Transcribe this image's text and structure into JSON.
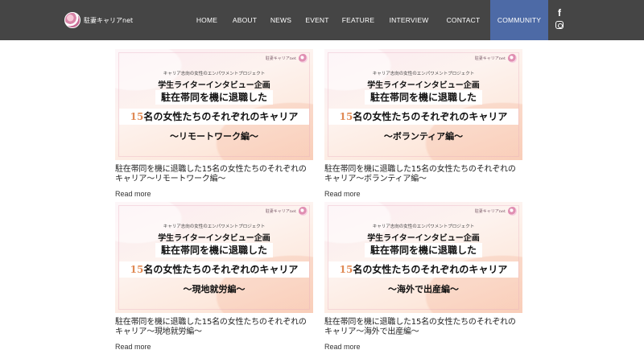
{
  "site": {
    "logo_text": "駐妻キャリアnet"
  },
  "nav": [
    {
      "label": "HOME",
      "active": false
    },
    {
      "label": "ABOUT",
      "active": false
    },
    {
      "label": "NEWS",
      "active": false
    },
    {
      "label": "EVENT",
      "active": false
    },
    {
      "label": "FEATURE",
      "active": false
    },
    {
      "label": "INTERVIEW",
      "active": false
    },
    {
      "label": "CONTACT",
      "active": false
    },
    {
      "label": "COMMUNITY",
      "active": true
    }
  ],
  "social": {
    "facebook_glyph": "f"
  },
  "thumb_common": {
    "brand": "駐妻キャリアnet",
    "project": "キャリア志向の女性のエンパワメントプロジェクト",
    "series": "学生ライターインタビュー企画",
    "line1": "駐在帯同を機に退職した",
    "line2_highlight": "15",
    "line2_rest": "名の女性たちのそれぞれのキャリア"
  },
  "posts": [
    {
      "edition": "～リモートワーク編～",
      "title": "駐在帯同を機に退職した15名の女性たちのそれぞれのキャリア〜リモートワーク編〜",
      "read_more": "Read more"
    },
    {
      "edition": "～ボランティア編～",
      "title": "駐在帯同を機に退職した15名の女性たちのそれぞれのキャリア〜ボランティア編〜",
      "read_more": "Read more"
    },
    {
      "edition": "～現地就労編～",
      "title": "駐在帯同を機に退職した15名の女性たちのそれぞれのキャリア〜現地就労編〜",
      "read_more": "Read more"
    },
    {
      "edition": "～海外で出産編～",
      "title": "駐在帯同を機に退職した15名の女性たちのそれぞれのキャリア〜海外で出産編〜",
      "read_more": "Read more"
    }
  ],
  "colors": {
    "header_bg": "#454545",
    "active_nav_bg": "#4d6aa6",
    "highlight_number": "#e08a55"
  }
}
